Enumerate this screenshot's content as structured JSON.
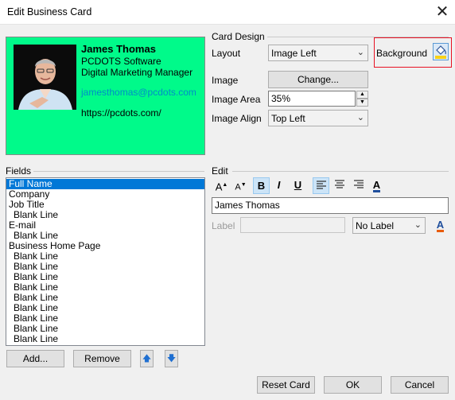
{
  "window": {
    "title": "Edit Business Card",
    "close_glyph": "✕"
  },
  "card": {
    "name": "James Thomas",
    "company": "PCDOTS Software",
    "job_title": "Digital Marketing Manager",
    "email": "jamesthomas@pcdots.com",
    "website": "https://pcdots.com/",
    "background_color": "#00fa8a"
  },
  "card_design": {
    "heading": "Card Design",
    "layout_label": "Layout",
    "layout_value": "Image Left",
    "background_label": "Background",
    "image_label": "Image",
    "change_button": "Change...",
    "image_area_label": "Image Area",
    "image_area_value": "35%",
    "image_align_label": "Image Align",
    "image_align_value": "Top Left"
  },
  "fields": {
    "heading": "Fields",
    "items": [
      {
        "label": "Full Name",
        "indent": false,
        "selected": true
      },
      {
        "label": "Company",
        "indent": false,
        "selected": false
      },
      {
        "label": "Job Title",
        "indent": false,
        "selected": false
      },
      {
        "label": "Blank Line",
        "indent": true,
        "selected": false
      },
      {
        "label": "E-mail",
        "indent": false,
        "selected": false
      },
      {
        "label": "Blank Line",
        "indent": true,
        "selected": false
      },
      {
        "label": "Business Home Page",
        "indent": false,
        "selected": false
      },
      {
        "label": "Blank Line",
        "indent": true,
        "selected": false
      },
      {
        "label": "Blank Line",
        "indent": true,
        "selected": false
      },
      {
        "label": "Blank Line",
        "indent": true,
        "selected": false
      },
      {
        "label": "Blank Line",
        "indent": true,
        "selected": false
      },
      {
        "label": "Blank Line",
        "indent": true,
        "selected": false
      },
      {
        "label": "Blank Line",
        "indent": true,
        "selected": false
      },
      {
        "label": "Blank Line",
        "indent": true,
        "selected": false
      },
      {
        "label": "Blank Line",
        "indent": true,
        "selected": false
      },
      {
        "label": "Blank Line",
        "indent": true,
        "selected": false
      }
    ],
    "add_button": "Add...",
    "remove_button": "Remove"
  },
  "edit": {
    "heading": "Edit",
    "value": "James Thomas",
    "label_label": "Label",
    "label_value": "",
    "label_position": "No Label",
    "bold_glyph": "B",
    "italic_glyph": "I",
    "underline_glyph": "U"
  },
  "footer": {
    "reset_button": "Reset Card",
    "ok_button": "OK",
    "cancel_button": "Cancel"
  }
}
